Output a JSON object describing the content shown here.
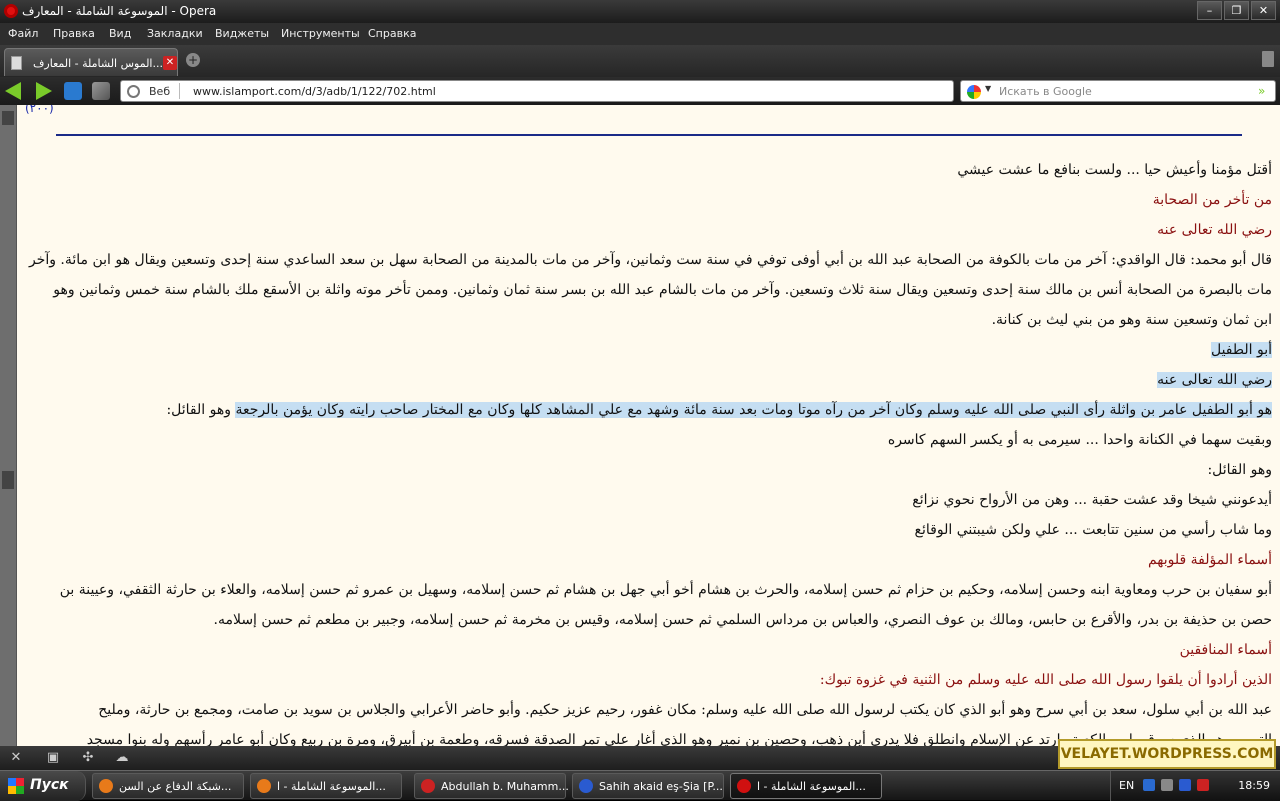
{
  "window": {
    "title": "الموسوعة الشاملة - المعارف - Opera"
  },
  "menu": [
    "Файл",
    "Правка",
    "Вид",
    "Закладки",
    "Виджеты",
    "Инструменты",
    "Справка"
  ],
  "tab": {
    "label": "الموس الشاملة - المعارف..."
  },
  "address": {
    "mode_label": "Веб",
    "url": "www.islamport.com/d/3/adb/1/122/702.html",
    "search_placeholder": "Искать в Google"
  },
  "page": {
    "top_fragment": "(۲۰۰)",
    "lines": [
      {
        "text": "أقتل مؤمنا وأعيش حيا ... ولست بنافع ما عشت عيشي",
        "style": "normal"
      },
      {
        "text": "من تأخر من الصحابة",
        "style": "red"
      },
      {
        "text": "رضي الله تعالى عنه",
        "style": "red"
      },
      {
        "text": "قال أبو محمد: قال الواقدي: آخر من مات بالكوفة من الصحابة عبد الله بن أبي أوفى توفي في سنة ست وثمانين، وآخر من مات بالمدينة من الصحابة سهل بن سعد الساعدي سنة إحدى وتسعين ويقال هو ابن مائة. وآخر من",
        "style": "full"
      },
      {
        "text": "مات بالبصرة من الصحابة أنس بن مالك سنة إحدى وتسعين ويقال سنة ثلاث وتسعين. وآخر من مات بالشام عبد الله بن بسر سنة ثمان وثمانين. وممن تأخر موته واثلة بن الأسقع ملك بالشام سنة خمس وثمانين وهو",
        "style": "full"
      },
      {
        "text": "ابن ثمان وتسعين سنة وهو من بني ليث بن كنانة.",
        "style": "normal"
      },
      {
        "text": "أبو الطفيل",
        "style": "highlight"
      },
      {
        "text": "رضي الله تعالى عنه",
        "style": "highlight"
      },
      {
        "text": "هو أبو الطفيل عامر بن واثلة رأى النبي صلى الله عليه وسلم وكان آخر من رآه موتا ومات بعد سنة مائة وشهد مع علي المشاهد كلها وكان مع المختار صاحب رايته  وكان يؤمن بالرجعة",
        "style": "highlight-partial",
        "tail": " وهو القائل:"
      },
      {
        "text": "وبقيت سهما في الكنانة واحدا ... سيرمى به أو يكسر السهم كاسره",
        "style": "normal"
      },
      {
        "text": "وهو القائل:",
        "style": "normal"
      },
      {
        "text": "أيدعونني شيخا وقد عشت حقبة ... وهن من الأرواح نحوي نزائع",
        "style": "normal"
      },
      {
        "text": "وما شاب رأسي من سنين تتابعت ... علي ولكن شيبتني الوقائع",
        "style": "normal"
      },
      {
        "text": "أسماء المؤلفة قلوبهم",
        "style": "red"
      },
      {
        "text": "أبو سفيان بن حرب ومعاوية ابنه وحسن إسلامه، وحكيم بن حزام ثم حسن إسلامه، والحرث بن هشام أخو أبي جهل بن هشام ثم حسن إسلامه، وسهيل بن عمرو ثم حسن إسلامه، والعلاء بن حارثة الثقفي، وعيينة بن",
        "style": "full"
      },
      {
        "text": "حصن بن حذيفة بن بدر، والأقرع بن حابس، ومالك بن عوف النصري، والعباس بن مرداس السلمي ثم حسن إسلامه، وقيس بن مخرمة ثم حسن إسلامه، وجبير بن مطعم ثم حسن إسلامه.",
        "style": "normal"
      },
      {
        "text": "أسماء المنافقين",
        "style": "red"
      },
      {
        "text": "الذين أرادوا أن يلقوا رسول الله صلى الله عليه وسلم من الثنية في غزوة تبوك:",
        "style": "red-partial"
      },
      {
        "text": "عبد الله بن أبي سلول، سعد بن أبي سرح وهو أبو الذي كان يكتب لرسول الله صلى الله عليه وسلم: مكان غفور، رحيم عزيز حكيم. وأبو حاضر الأعرابي والجلاس بن سويد بن صامت، ومجمع بن حارثة، ومليح",
        "style": "full"
      },
      {
        "text": "التيمي وهو الذي سرق طيب الكعبة وارتد عن الإسلام وانطلق فلا يدري أين ذهب، وحصين بن نمير وهو الذي أغار على تمر الصدقة فسرقه، وطعمة بن أبيرق، ومرة بن ربيع وكان أبو عامر رأسهم وله بنوا مسجد",
        "style": "full"
      }
    ]
  },
  "watermark": "VELAYET.WORDPRESS.COM",
  "taskbar": {
    "start_label": "Пуск",
    "tasks": [
      {
        "label": "شبكة الدفاع عن السن...",
        "icon_color": "#e87a1a"
      },
      {
        "label": "الموسوعة الشاملة - ا...",
        "icon_color": "#e87a1a"
      },
      {
        "label": "Abdullah b. Muhamm...",
        "icon_color": "#c22"
      },
      {
        "label": "Sahih akaid eş-Şia [P...",
        "icon_color": "#2a5bd0"
      },
      {
        "label": "الموسوعة الشاملة - ا...",
        "icon_color": "#d01010"
      }
    ],
    "lang": "EN",
    "clock": "18:59"
  }
}
